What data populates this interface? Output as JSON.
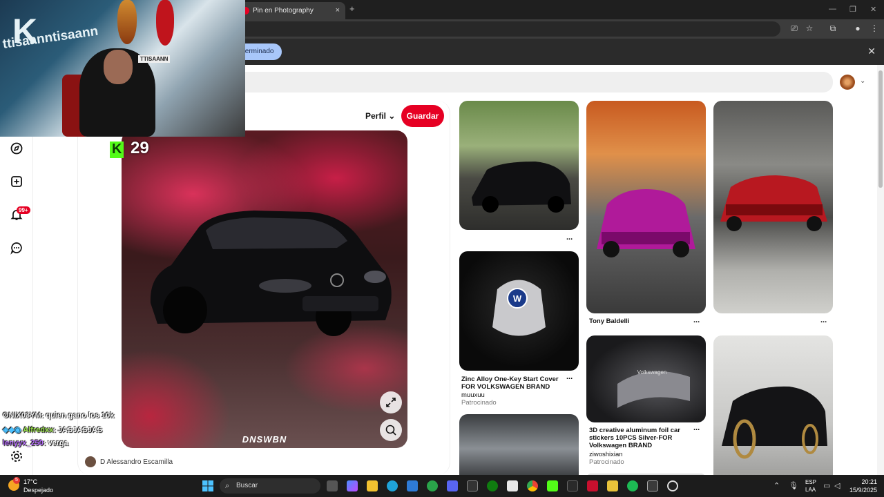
{
  "browser": {
    "tab_title": "Pin en Photography",
    "tab_close": "×",
    "new_tab": "+",
    "window_controls": [
      "—",
      "❐",
      "✕"
    ],
    "infobar_text": "orte terminado",
    "infobar_close": "✕"
  },
  "pin": {
    "profile_label": "Perfil",
    "save_label": "Guardar",
    "image_watermark": "DNSWBN",
    "author": "D Alessandro Escamilla"
  },
  "nav": {
    "notification_badge": "99+"
  },
  "grid": {
    "pins": [
      {
        "title": "",
        "more": "..."
      },
      {
        "title": "Zinc Alloy One-Key Start Cover FOR VOLKSWAGEN BRAND",
        "subtitle": "muuxuu",
        "meta": "Patrocinado",
        "more": "..."
      },
      {
        "title": "Tony Baldelli",
        "more": "..."
      },
      {
        "title": "3D creative aluminum foil car stickers 10PCS Silver-FOR Volkswagen BRAND",
        "subtitle": "ziwoshixian",
        "meta": "Patrocinado",
        "more": "..."
      },
      {
        "title": "",
        "more": "..."
      }
    ]
  },
  "stream": {
    "webcam_name": "ttisaanntisaann",
    "webcam_logo": "K",
    "sign_text": "TTISAANN",
    "viewer_count": "29",
    "chat": [
      {
        "user": "ONIX03YM",
        "message": ": quien gano los 10k",
        "color": "#e8e8e8"
      },
      {
        "user": "Alfredxx",
        "message": ": JASJASJAS",
        "color": "#9be34a"
      },
      {
        "user": "lenyyx_250",
        "message": ": verga",
        "color": "#b86cff"
      }
    ]
  },
  "taskbar": {
    "temperature": "17°C",
    "condition": "Despejado",
    "weather_badge": "5",
    "search_label": "Buscar",
    "lang_1": "ESP",
    "lang_2": "LAA",
    "time": "20:21",
    "date": "15/9/2025"
  },
  "colors": {
    "accent": "#e60023",
    "kick_green": "#53fc18",
    "infobar_chip": "#a8c7fa"
  }
}
